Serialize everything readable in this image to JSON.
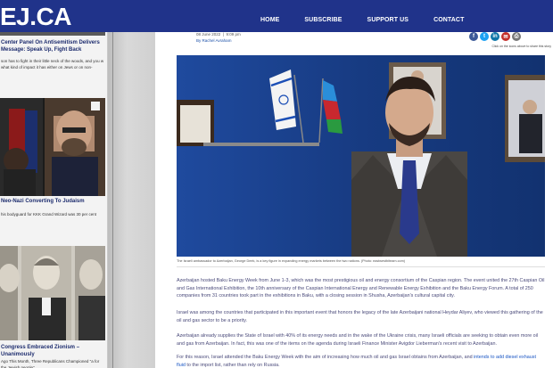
{
  "site": {
    "logo": "EJ.CA",
    "nav": [
      "HOME",
      "SUBSCRIBE",
      "SUPPORT US",
      "CONTACT"
    ],
    "colors": {
      "header": "#20338a",
      "link": "#1a56c4"
    }
  },
  "sidebar": {
    "items": [
      {
        "title": "Center Panel On Antisemitism Delivers Message: Speak Up, Fight Back",
        "text": "son has to fight in their little neck of the woods, and you w what kind of impact it has either on Jews or on non-"
      },
      {
        "title": "Neo-Nazi Converting To Judaism",
        "text": "his bodyguard for KKK Grand Wizard was 30 per cent"
      },
      {
        "title": "Congress Embraced Zionism – Unanimously",
        "text": "Ago This Month, Three Republicans Championed \"a for the Jewish people\""
      }
    ]
  },
  "article": {
    "date": "08 June 2022",
    "time": "9:09 pm",
    "byline": "By Rachel Avraham",
    "share_icons": [
      "facebook-icon",
      "twitter-icon",
      "linkedin-icon",
      "email-icon",
      "print-icon"
    ],
    "share_note": "Click on the icons above to share this story",
    "caption": "The Israeli ambassador to Azerbaijan, George Deek, is a key figure in expanding energy markets between the two nations. (Photo: eastwestbiteam.com)",
    "paragraphs": [
      "Azerbaijan hosted Baku Energy Week from June 1-3, which was the most prestigious oil and energy consortium of the Caspian region. The event united the 27th Caspian Oil and Gas International Exhibition, the 10th anniversary of the Caspian International Energy and Renewable Energy Exhibition and the Baku Energy Forum.  A total of 250 companies from 31 countries took part in the exhibitions in Baku, with a closing session in Shusha, Azerbaijan's cultural capital city.",
      "Israel was among the countries that participated in this important event that honors the legacy of the late Azerbaijani national Heydar Aliyev, who viewed this gathering of the oil and gas sector to be a priority.",
      "Azerbaijan already supplies the State of Israel with 40% of its energy needs and in the wake of the Ukraine crisis, many Israeli officials are seeking to obtain even more oil and gas from Azerbaijan. In fact, this was one of the items on the agenda during Israeli Finance Minister Avigdor Lieberman's recent visit to Azerbaijan."
    ],
    "p4_prefix": "For this reason, Israel attended the Baku Energy Week with the aim of increasing how much oil and gas Israel obtains from Azerbaijan, and ",
    "p4_link": "intends to add diesel exhaust fluid",
    "p4_suffix": " to the import list, rather than rely on Russia."
  }
}
